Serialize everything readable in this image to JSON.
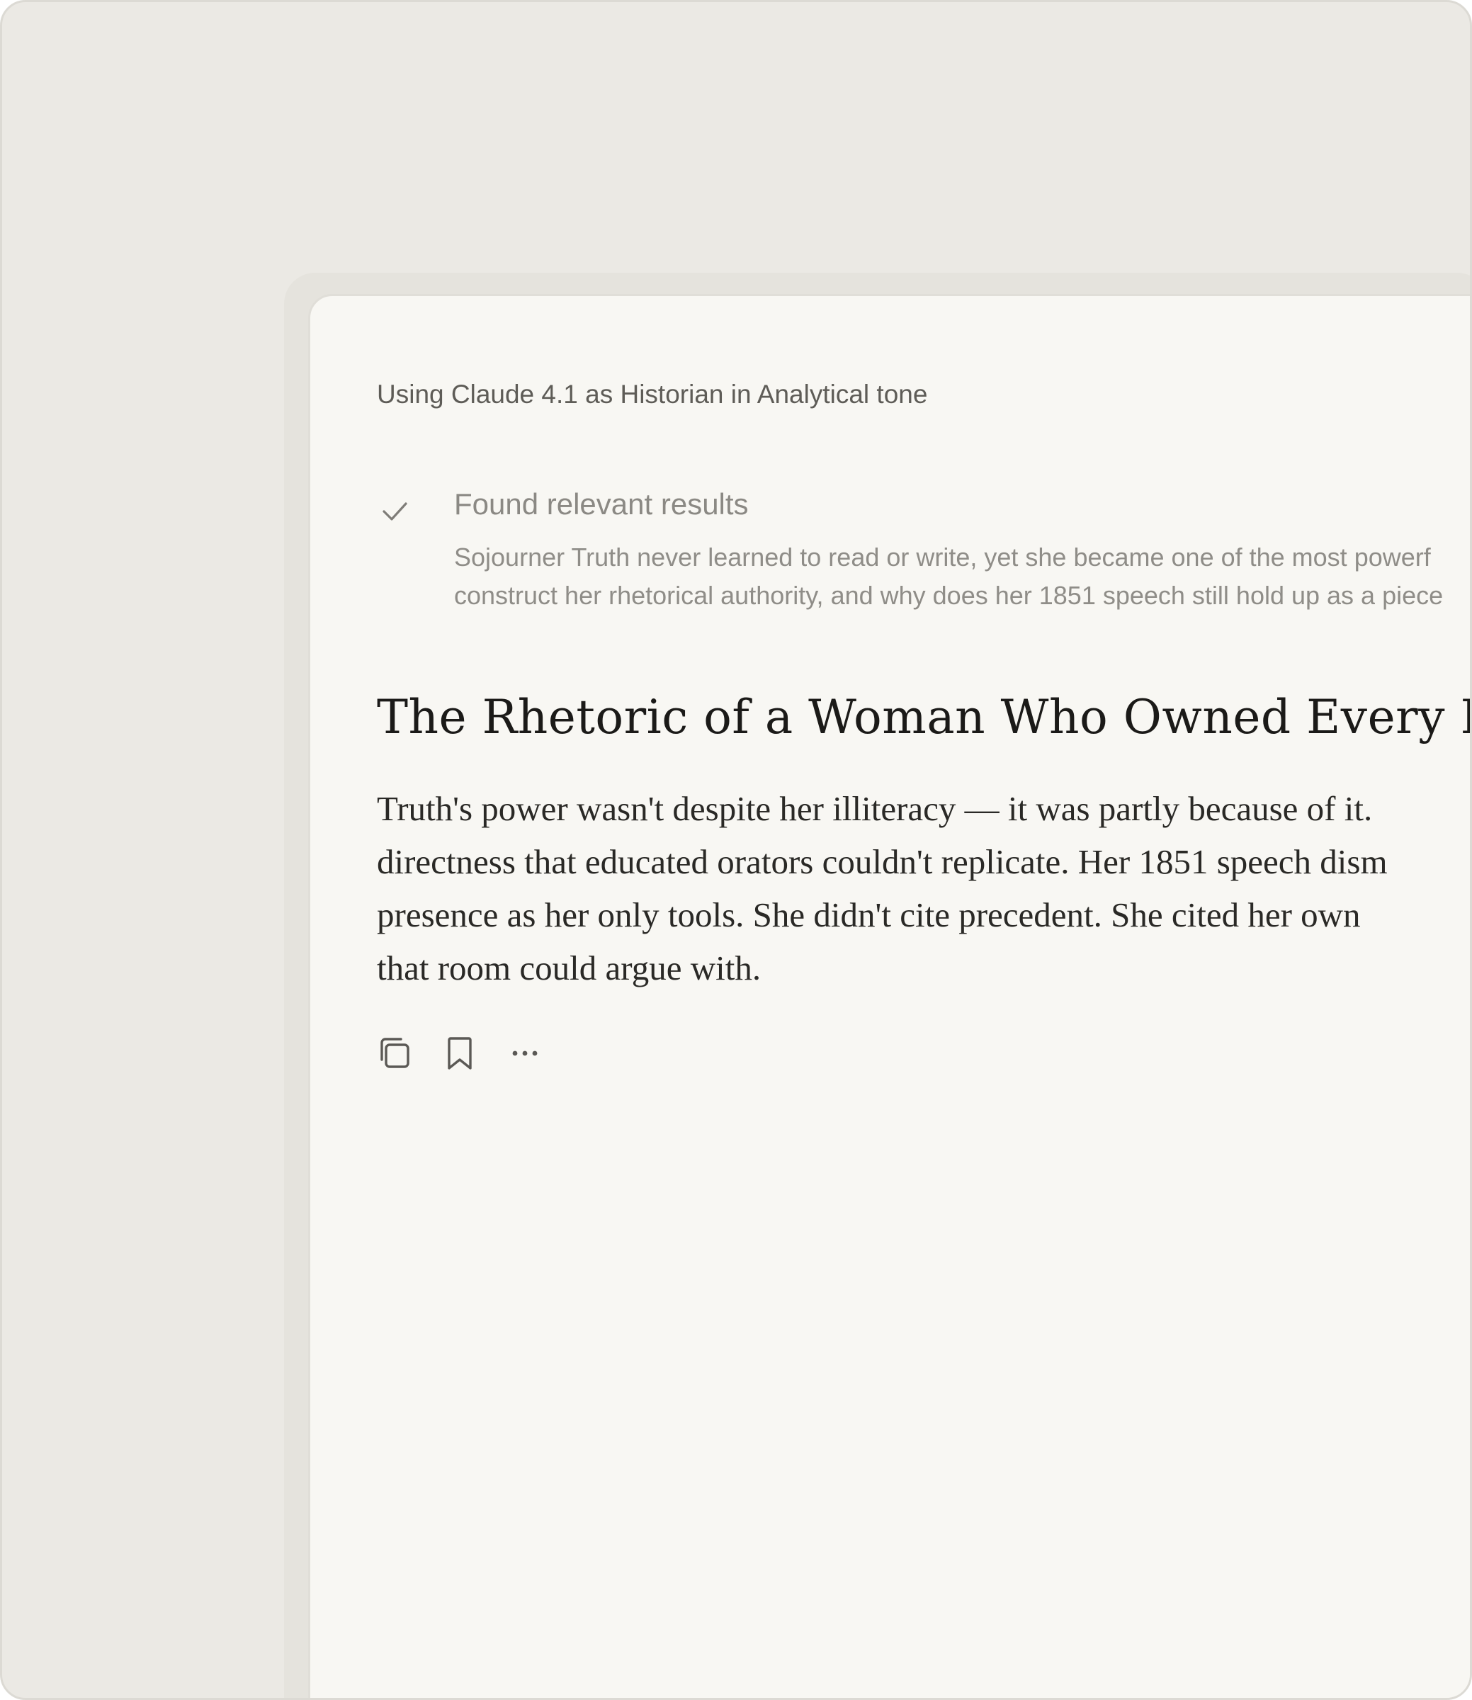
{
  "header": {
    "meta": "Using Claude 4.1 as Historian in Analytical tone"
  },
  "status": {
    "icon": "check-icon",
    "title": "Found relevant results",
    "description_lines": [
      "Sojourner Truth never learned to read or write, yet she became one of the most powerf",
      "construct her rhetorical authority, and why does her 1851 speech still hold up as a piece"
    ]
  },
  "article": {
    "title": "The Rhetoric of a Woman Who Owned Every Roo",
    "body_lines": [
      "Truth's power wasn't despite her illiteracy — it was partly because of it.",
      "directness that educated orators couldn't replicate. Her 1851 speech dism",
      "presence as her only tools. She didn't cite precedent. She cited her own",
      "that room could argue with."
    ]
  },
  "actions": {
    "icons": [
      "copy-icon",
      "bookmark-icon",
      "more-icon"
    ]
  },
  "colors": {
    "frame_background": "#ebe9e4",
    "panel_background": "#f8f7f3",
    "title_text": "#1b1a18",
    "muted_text": "#8b8984"
  }
}
